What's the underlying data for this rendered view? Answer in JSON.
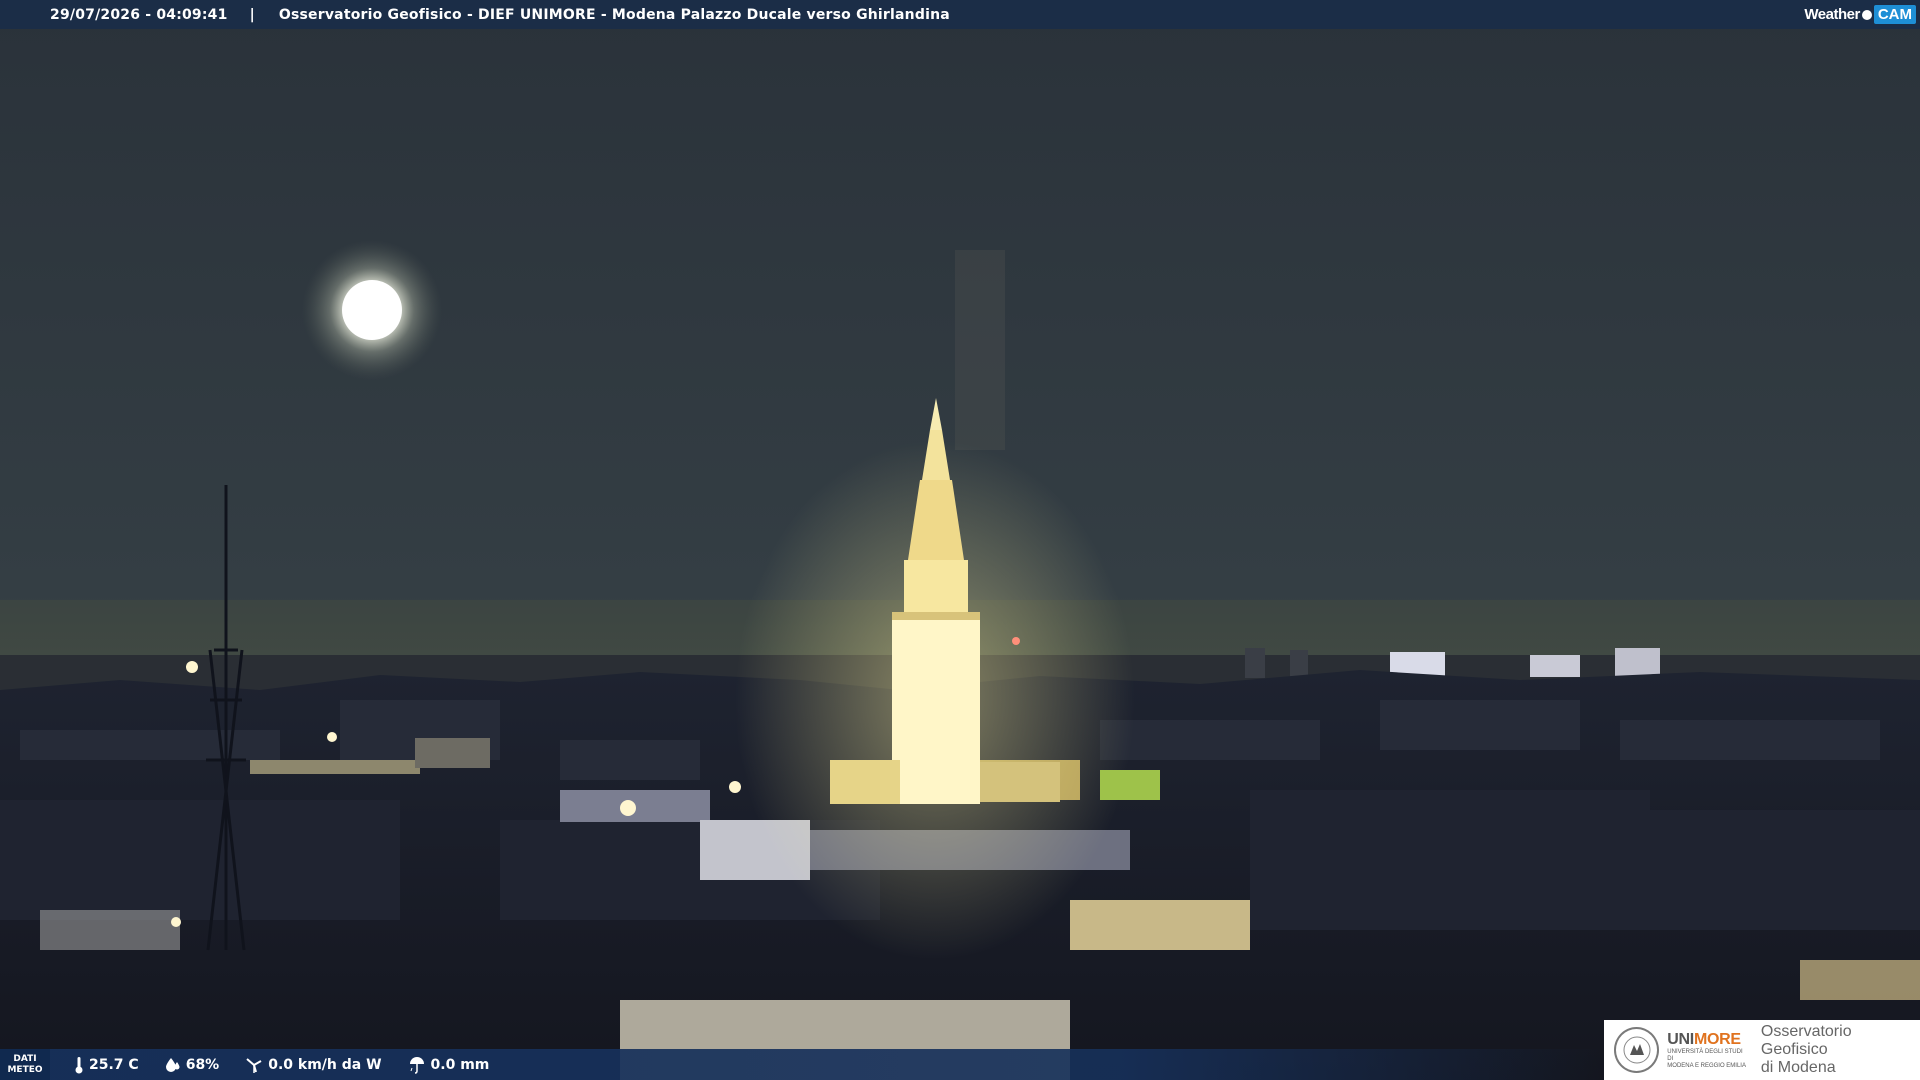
{
  "header": {
    "timestamp": "29/07/2026 - 04:09:41",
    "separator": "|",
    "title": "Osservatorio Geofisico - DIEF UNIMORE - Modena Palazzo Ducale verso Ghirlandina"
  },
  "brand": {
    "left": "Weather",
    "right": "CAM"
  },
  "meteo": {
    "label_line1": "DATI",
    "label_line2": "METEO",
    "temperature": "25.7 C",
    "humidity": "68%",
    "wind": "0.0 km/h da W",
    "rain": "0.0 mm",
    "icons": [
      "thermometer-icon",
      "humidity-drop-icon",
      "wind-icon",
      "rain-icon"
    ]
  },
  "logo": {
    "uni_part1": "UNI",
    "uni_part2": "MORE",
    "uni_sub1": "UNIVERSITÀ DEGLI STUDI DI",
    "uni_sub2": "MODENA E REGGIO EMILIA",
    "obs_line1": "Osservatorio Geofisico",
    "obs_line2": "di Modena",
    "accent_color": "#e0731f"
  },
  "colors": {
    "header_bg": "#1b2d47",
    "footer_bg": "#16305a",
    "sky": "#2c3540",
    "tower_light": "#fff6c8"
  }
}
